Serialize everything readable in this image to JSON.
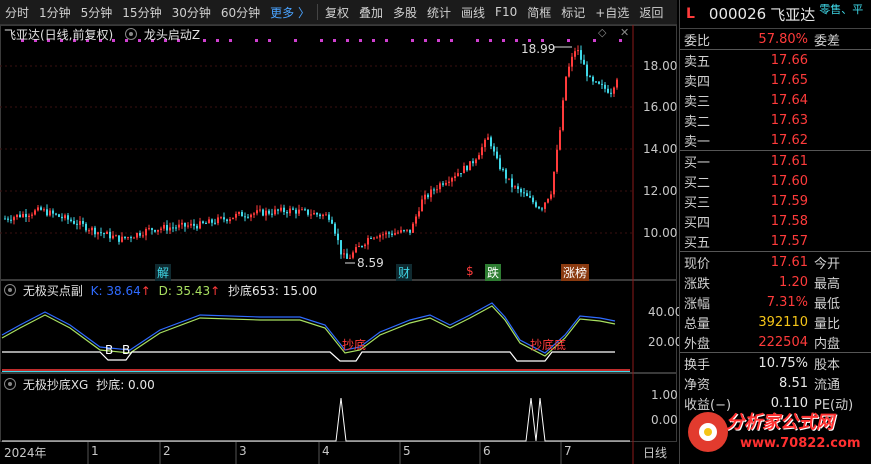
{
  "toolbar": {
    "items": [
      "分时",
      "1分钟",
      "5分钟",
      "15分钟",
      "30分钟",
      "60分钟",
      "更多 〉",
      "复权",
      "叠加",
      "多股",
      "统计",
      "画线",
      "F10",
      "简框",
      "标记",
      "+自选",
      "返回"
    ]
  },
  "main_chart": {
    "title": "飞亚达(日线,前复权)",
    "indicator": "龙头启动Z",
    "high_label": "18.99",
    "low_label": "8.59",
    "y_ticks": [
      "18.00",
      "16.00",
      "14.00",
      "12.00",
      "10.00"
    ],
    "markers": [
      "解",
      "财",
      "$",
      "跌",
      "涨榜"
    ]
  },
  "indicator1": {
    "name": "无极买点副",
    "k_label": "K: 38.64",
    "d_label": "D: 35.43",
    "chaodi_label": "抄底653: 15.00",
    "y_ticks": [
      "40.00",
      "20.00"
    ],
    "annotations": [
      "B",
      "B",
      "抄底",
      "抄底底"
    ]
  },
  "indicator2": {
    "name": "无极抄底XG",
    "value_label": "抄底: 0.00",
    "y_ticks": [
      "1.00",
      "0.00"
    ]
  },
  "x_axis": {
    "labels": [
      "2024年",
      "1",
      "2",
      "3",
      "4",
      "5",
      "6",
      "7"
    ],
    "right_label": "日线"
  },
  "right_panel": {
    "logo": "L",
    "code": "000026",
    "name": "飞亚达",
    "tag": "零售、平",
    "webi_label": "委比",
    "webi_value": "57.80%",
    "weicha_label": "委差",
    "asks": [
      {
        "label": "卖五",
        "price": "17.66"
      },
      {
        "label": "卖四",
        "price": "17.65"
      },
      {
        "label": "卖三",
        "price": "17.64"
      },
      {
        "label": "卖二",
        "price": "17.63"
      },
      {
        "label": "卖一",
        "price": "17.62"
      }
    ],
    "bids": [
      {
        "label": "买一",
        "price": "17.61"
      },
      {
        "label": "买二",
        "price": "17.60"
      },
      {
        "label": "买三",
        "price": "17.59"
      },
      {
        "label": "买四",
        "price": "17.58"
      },
      {
        "label": "买五",
        "price": "17.57"
      }
    ],
    "stats": [
      {
        "label": "现价",
        "value": "17.61",
        "label2": "今开"
      },
      {
        "label": "涨跌",
        "value": "1.20",
        "label2": "最高"
      },
      {
        "label": "涨幅",
        "value": "7.31%",
        "label2": "最低"
      },
      {
        "label": "总量",
        "value": "392110",
        "label2": "量比"
      },
      {
        "label": "外盘",
        "value": "222504",
        "label2": "内盘"
      }
    ],
    "stats2": [
      {
        "label": "换手",
        "value": "10.75%",
        "label2": "股本"
      },
      {
        "label": "净资",
        "value": "8.51",
        "label2": "流通"
      },
      {
        "label": "收益(−)",
        "value": "0.110",
        "label2": "PE(动)"
      }
    ],
    "watermark": "分析家公式网",
    "watermark_url": "www.70822.com"
  },
  "colors": {
    "up": "#ff3b3b",
    "down": "#3fd8e8",
    "k_line": "#2f6bff",
    "d_line": "#a8e060",
    "white": "#ffffff"
  }
}
